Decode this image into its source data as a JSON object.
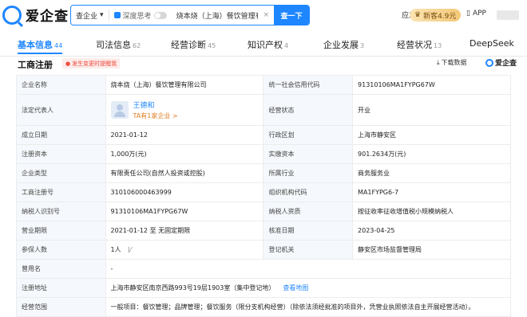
{
  "header": {
    "logo_text": "爱企查",
    "search": {
      "type_label": "查企业",
      "deep_label": "深度思考",
      "query": "烧本烧（上海）餐饮管理有限公司",
      "clear": "×",
      "button": "查一下"
    },
    "apply_label": "应用",
    "vip_label": "新客4.9元",
    "app_label": "APP"
  },
  "tabs": [
    {
      "label": "基本信息",
      "count": "44"
    },
    {
      "label": "司法信息",
      "count": "62"
    },
    {
      "label": "经营诊断",
      "count": "45"
    },
    {
      "label": "知识产权",
      "count": "4"
    },
    {
      "label": "企业发展",
      "count": "3"
    },
    {
      "label": "经营状况",
      "count": "13"
    },
    {
      "label": "DeepSeek",
      "count": ""
    }
  ],
  "section": {
    "title": "工商注册",
    "badge": "发生变更时提醒我",
    "download": "下载数据",
    "brand": "爱企查"
  },
  "info": {
    "company_name_label": "企业名称",
    "company_name": "烧本烧（上海）餐饮管理有限公司",
    "credit_code_label": "统一社会信用代码",
    "credit_code": "91310106MA1FYPG67W",
    "legal_rep_label": "法定代表人",
    "legal_rep_name": "王德和",
    "legal_rep_sub": "TA有1家企业 >",
    "status_label": "经营状态",
    "status": "开业",
    "founded_label": "成立日期",
    "founded": "2021-01-12",
    "district_label": "行政区划",
    "district": "上海市静安区",
    "reg_capital_label": "注册资本",
    "reg_capital": "1,000万(元)",
    "paid_capital_label": "实缴资本",
    "paid_capital": "901.2634万(元)",
    "type_label": "企业类型",
    "type": "有限责任公司(自然人投资或控股)",
    "industry_label": "所属行业",
    "industry": "商务服务业",
    "reg_no_label": "工商注册号",
    "reg_no": "310106000463999",
    "org_code_label": "组织机构代码",
    "org_code": "MA1FYPG6-7",
    "taxpayer_id_label": "纳税人识别号",
    "taxpayer_id": "91310106MA1FYPG67W",
    "taxpayer_qual_label": "纳税人资质",
    "taxpayer_qual": "按征收率征收增值税小规模纳税人",
    "term_label": "营业期限",
    "term": "2021-01-12 至 无固定期限",
    "approval_label": "核准日期",
    "approval": "2023-04-25",
    "insured_label": "参保人数",
    "insured": "1人",
    "authority_label": "登记机关",
    "authority": "静安区市场监督管理局",
    "former_name_label": "曾用名",
    "former_name": "-",
    "address_label": "注册地址",
    "address": "上海市静安区南京西路993号19层1903室（集中登记地）",
    "map_link": "查看地图",
    "scope_label": "经营范围",
    "scope": "一般项目：餐饮管理；品牌管理；餐饮服务（限分支机构经营）（除依法须经批准的项目外，凭营业执照依法自主开展经营活动）。"
  }
}
